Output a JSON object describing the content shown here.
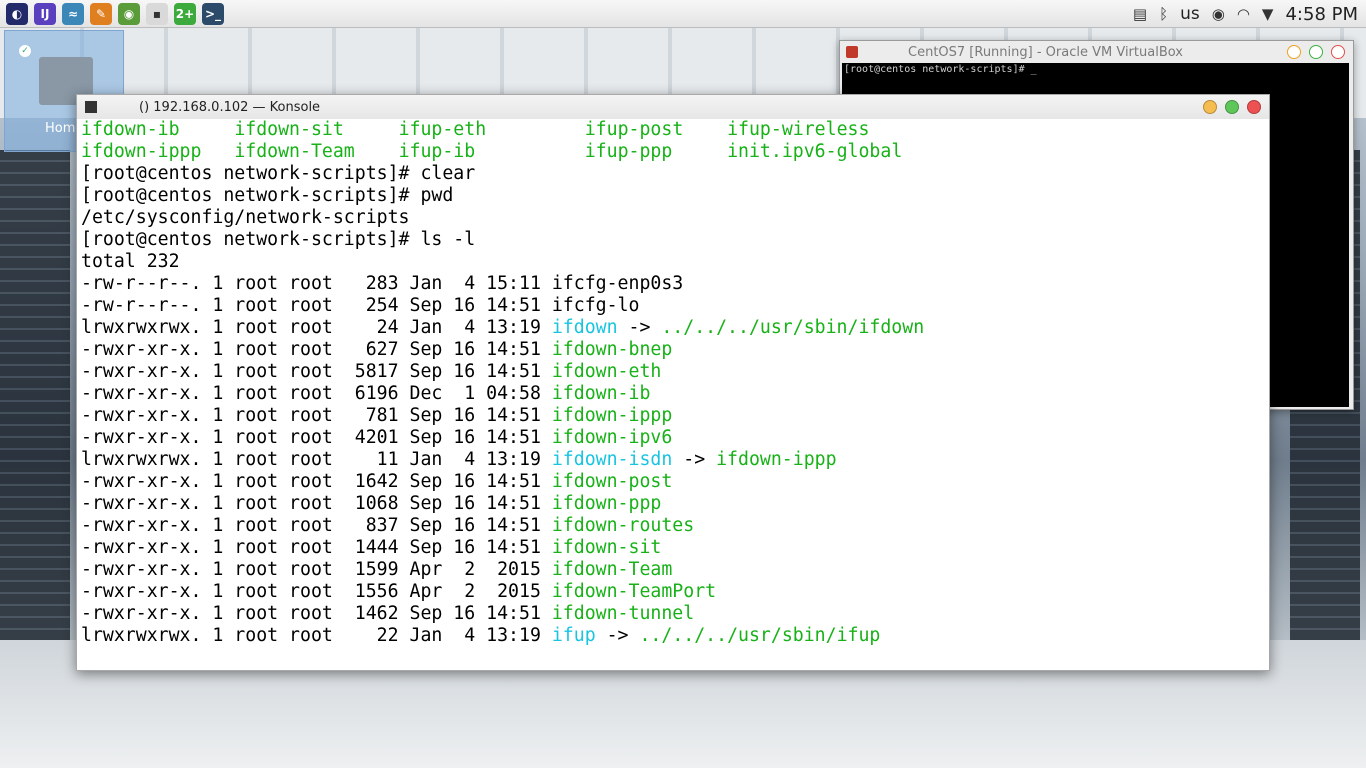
{
  "panel": {
    "launchers": [
      {
        "name": "app-menu-icon",
        "glyph": "◐",
        "color": "#222a6a"
      },
      {
        "name": "intellij-icon",
        "glyph": "IJ",
        "color": "#5a3fbf"
      },
      {
        "name": "network-tool-icon",
        "glyph": "≈",
        "color": "#3a87b8"
      },
      {
        "name": "gimp-icon",
        "glyph": "✎",
        "color": "#e07f20"
      },
      {
        "name": "android-studio-icon",
        "glyph": "◉",
        "color": "#5a9b3a"
      },
      {
        "name": "photo-viewer-icon",
        "glyph": "▪",
        "color": "#d9d9d9"
      },
      {
        "name": "chat-app-icon",
        "glyph": "2+",
        "color": "#3daa3d"
      },
      {
        "name": "terminal-icon",
        "glyph": ">_",
        "color": "#2c4a6a"
      }
    ],
    "tray": {
      "keyboard_layout": "us",
      "clock": "4:58 PM"
    }
  },
  "desktop": {
    "home_icon_label": "Hom"
  },
  "vbox": {
    "title": "CentOS7 [Running] - Oracle VM VirtualBox",
    "screen_line": "[root@centos network-scripts]# _"
  },
  "konsole": {
    "title": "() 192.168.0.102 — Konsole",
    "lines": [
      [
        [
          "ifdown-ib     ",
          "g"
        ],
        [
          "ifdown-sit     ",
          "g"
        ],
        [
          "ifup-eth         ",
          "g"
        ],
        [
          "ifup-post    ",
          "g"
        ],
        [
          "ifup-wireless",
          "g"
        ]
      ],
      [
        [
          "ifdown-ippp   ",
          "g"
        ],
        [
          "ifdown-Team    ",
          "g"
        ],
        [
          "ifup-ib          ",
          "g"
        ],
        [
          "ifup-ppp     ",
          "g"
        ],
        [
          "init.ipv6-global",
          "g"
        ]
      ],
      [
        [
          "[root@centos network-scripts]# clear",
          ""
        ]
      ],
      [
        [
          "[root@centos network-scripts]# pwd",
          ""
        ]
      ],
      [
        [
          "/etc/sysconfig/network-scripts",
          ""
        ]
      ],
      [
        [
          "[root@centos network-scripts]# ls -l",
          ""
        ]
      ],
      [
        [
          "total 232",
          ""
        ]
      ],
      [
        [
          "-rw-r--r--. 1 root root   283 Jan  4 15:11 ",
          ""
        ],
        [
          "ifcfg-enp0s3",
          ""
        ]
      ],
      [
        [
          "-rw-r--r--. 1 root root   254 Sep 16 14:51 ",
          ""
        ],
        [
          "ifcfg-lo",
          ""
        ]
      ],
      [
        [
          "lrwxrwxrwx. 1 root root    24 Jan  4 13:19 ",
          ""
        ],
        [
          "ifdown",
          "c"
        ],
        [
          " -> ",
          ""
        ],
        [
          "../../../usr/sbin/ifdown",
          "g"
        ]
      ],
      [
        [
          "-rwxr-xr-x. 1 root root   627 Sep 16 14:51 ",
          ""
        ],
        [
          "ifdown-bnep",
          "g"
        ]
      ],
      [
        [
          "-rwxr-xr-x. 1 root root  5817 Sep 16 14:51 ",
          ""
        ],
        [
          "ifdown-eth",
          "g"
        ]
      ],
      [
        [
          "-rwxr-xr-x. 1 root root  6196 Dec  1 04:58 ",
          ""
        ],
        [
          "ifdown-ib",
          "g"
        ]
      ],
      [
        [
          "-rwxr-xr-x. 1 root root   781 Sep 16 14:51 ",
          ""
        ],
        [
          "ifdown-ippp",
          "g"
        ]
      ],
      [
        [
          "-rwxr-xr-x. 1 root root  4201 Sep 16 14:51 ",
          ""
        ],
        [
          "ifdown-ipv6",
          "g"
        ]
      ],
      [
        [
          "lrwxrwxrwx. 1 root root    11 Jan  4 13:19 ",
          ""
        ],
        [
          "ifdown-isdn",
          "c"
        ],
        [
          " -> ",
          ""
        ],
        [
          "ifdown-ippp",
          "g"
        ]
      ],
      [
        [
          "-rwxr-xr-x. 1 root root  1642 Sep 16 14:51 ",
          ""
        ],
        [
          "ifdown-post",
          "g"
        ]
      ],
      [
        [
          "-rwxr-xr-x. 1 root root  1068 Sep 16 14:51 ",
          ""
        ],
        [
          "ifdown-ppp",
          "g"
        ]
      ],
      [
        [
          "-rwxr-xr-x. 1 root root   837 Sep 16 14:51 ",
          ""
        ],
        [
          "ifdown-routes",
          "g"
        ]
      ],
      [
        [
          "-rwxr-xr-x. 1 root root  1444 Sep 16 14:51 ",
          ""
        ],
        [
          "ifdown-sit",
          "g"
        ]
      ],
      [
        [
          "-rwxr-xr-x. 1 root root  1599 Apr  2  2015 ",
          ""
        ],
        [
          "ifdown-Team",
          "g"
        ]
      ],
      [
        [
          "-rwxr-xr-x. 1 root root  1556 Apr  2  2015 ",
          ""
        ],
        [
          "ifdown-TeamPort",
          "g"
        ]
      ],
      [
        [
          "-rwxr-xr-x. 1 root root  1462 Sep 16 14:51 ",
          ""
        ],
        [
          "ifdown-tunnel",
          "g"
        ]
      ],
      [
        [
          "lrwxrwxrwx. 1 root root    22 Jan  4 13:19 ",
          ""
        ],
        [
          "ifup",
          "c"
        ],
        [
          " -> ",
          ""
        ],
        [
          "../../../usr/sbin/ifup",
          "g"
        ]
      ]
    ]
  }
}
